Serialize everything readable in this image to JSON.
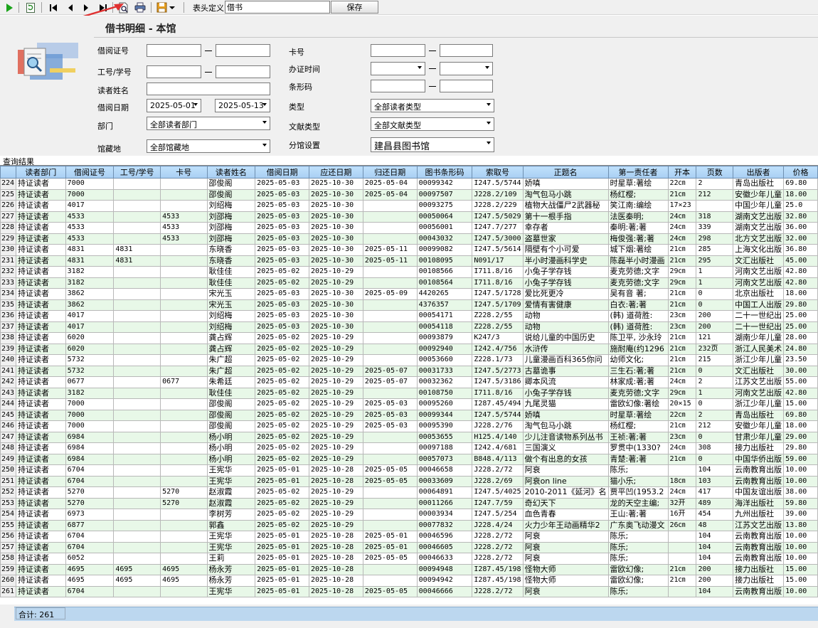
{
  "toolbar": {
    "header_def_label": "表头定义",
    "header_def_value": "借书",
    "save_label": "保存"
  },
  "page": {
    "title": "借书明细 - 本馆"
  },
  "filters": {
    "card_no_label": "借阅证号",
    "staff_no_label": "工号/学号",
    "reader_name_label": "读者姓名",
    "borrow_date_label": "借阅日期",
    "borrow_date_from": "2025-05-01",
    "borrow_date_to": "2025-05-13",
    "dept_label": "部门",
    "dept_value": "全部读者部门",
    "library_label": "馆藏地",
    "library_value": "全部馆藏地",
    "kahao_label": "卡号",
    "issue_time_label": "办证时间",
    "barcode_label": "条形码",
    "type_label": "类型",
    "type_value": "全部读者类型",
    "doc_type_label": "文献类型",
    "doc_type_value": "全部文献类型",
    "branch_label": "分馆设置",
    "branch_value": "建昌县图书馆"
  },
  "results_label": "查询结果",
  "table": {
    "columns": [
      "读者部门",
      "借阅证号",
      "工号/学号",
      "卡号",
      "读者姓名",
      "借阅日期",
      "应还日期",
      "归还日期",
      "图书条形码",
      "索取号",
      "正题名",
      "第一责任者",
      "开本",
      "页数",
      "出版者",
      "价格"
    ],
    "rows": [
      [
        "224",
        "持证读者",
        "7000",
        "",
        "",
        "邵俊阁",
        "2025-05-03",
        "2025-10-30",
        "2025-05-04",
        "00099342",
        "I247.5/5744",
        "娇嗔",
        "时星草:著绘",
        "22㎝",
        "2",
        "青岛出版社",
        "69.80"
      ],
      [
        "225",
        "持证读者",
        "7000",
        "",
        "",
        "邵俊阁",
        "2025-05-03",
        "2025-10-30",
        "2025-05-04",
        "00097507",
        "J228.2/109",
        "淘气包马小跳",
        "杨红樱;",
        "21㎝",
        "212",
        "安徽少年儿童",
        "18.00"
      ],
      [
        "226",
        "持证读者",
        "4017",
        "",
        "",
        "刘绍梅",
        "2025-05-03",
        "2025-10-30",
        "",
        "00093275",
        "J228.2/229",
        "植物大战僵尸2武器秘",
        "笑江南:编绘",
        "17×23",
        "",
        "中国少年儿童",
        "25.0"
      ],
      [
        "227",
        "持证读者",
        "4533",
        "",
        "4533",
        "刘邵梅",
        "2025-05-03",
        "2025-10-30",
        "",
        "00050064",
        "I247.5/5029",
        "第十一根手指",
        "法医秦明;",
        "24㎝",
        "318",
        "湖南文艺出版",
        "32.80"
      ],
      [
        "228",
        "持证读者",
        "4533",
        "",
        "4533",
        "刘邵梅",
        "2025-05-03",
        "2025-10-30",
        "",
        "00056001",
        "I247.7/277",
        "幸存者",
        "秦明:著;著",
        "24㎝",
        "339",
        "湖南文艺出版",
        "36.00"
      ],
      [
        "229",
        "持证读者",
        "4533",
        "",
        "4533",
        "刘邵梅",
        "2025-05-03",
        "2025-10-30",
        "",
        "00043032",
        "I247.5/3000",
        "盗墓世家",
        "梅俊强:著;著",
        "24㎝",
        "298",
        "北方文艺出版",
        "32.00"
      ],
      [
        "230",
        "持证读者",
        "4831",
        "4831",
        "",
        "东晓香",
        "2025-05-03",
        "2025-10-30",
        "2025-05-11",
        "00099082",
        "I247.5/5614",
        "隔壁有个小可爱",
        "城下烟:著绘",
        "21㎝",
        "285",
        "上海文化出版",
        "36.80"
      ],
      [
        "231",
        "持证读者",
        "4831",
        "4831",
        "",
        "东晓香",
        "2025-05-03",
        "2025-10-30",
        "2025-05-11",
        "00108095",
        "N091/17",
        "半小时漫画科学史",
        "陈磊半小时漫画",
        "21㎝",
        "295",
        "文汇出版社",
        "45.00"
      ],
      [
        "232",
        "持证读者",
        "3182",
        "",
        "",
        "耿佳佳",
        "2025-05-02",
        "2025-10-29",
        "",
        "00108566",
        "I711.8/16",
        "小兔子学存钱",
        "麦克劳德;文字",
        "29㎝",
        "1",
        "河南文艺出版",
        "42.80"
      ],
      [
        "233",
        "持证读者",
        "3182",
        "",
        "",
        "耿佳佳",
        "2025-05-02",
        "2025-10-29",
        "",
        "00108564",
        "I711.8/16",
        "小兔子学存钱",
        "麦克劳德;文字",
        "29㎝",
        "1",
        "河南文艺出版",
        "42.80"
      ],
      [
        "234",
        "持证读者",
        "3862",
        "",
        "",
        "宋光玉",
        "2025-05-03",
        "2025-10-30",
        "2025-05-09",
        "4420265",
        "I247.5/1728",
        "爱比死更冷",
        "吴有音 著;",
        "21㎝",
        "0",
        "北京出版社",
        "18.00"
      ],
      [
        "235",
        "持证读者",
        "3862",
        "",
        "",
        "宋光玉",
        "2025-05-03",
        "2025-10-30",
        "",
        "4376357",
        "I247.5/1709",
        "爱情有害健康",
        "白衣:著;著",
        "21㎝",
        "0",
        "中国工人出版",
        "29.80"
      ],
      [
        "236",
        "持证读者",
        "4017",
        "",
        "",
        "刘绍梅",
        "2025-05-03",
        "2025-10-30",
        "",
        "00054171",
        "Z228.2/55",
        "动物",
        "(韩) 道荷胜:",
        "23㎝",
        "200",
        "二十一世纪出",
        "25.00"
      ],
      [
        "237",
        "持证读者",
        "4017",
        "",
        "",
        "刘绍梅",
        "2025-05-03",
        "2025-10-30",
        "",
        "00054118",
        "Z228.2/55",
        "动物",
        "(韩) 道荷胜:",
        "23㎝",
        "200",
        "二十一世纪出",
        "25.00"
      ],
      [
        "238",
        "持证读者",
        "6020",
        "",
        "",
        "龚占辉",
        "2025-05-02",
        "2025-10-29",
        "",
        "00093879",
        "K247/3",
        "说给儿童的中国历史",
        "陈卫平, 沙永玲",
        "21㎝",
        "121",
        "湖南少年儿童",
        "28.00"
      ],
      [
        "239",
        "持证读者",
        "6020",
        "",
        "",
        "龚占辉",
        "2025-05-02",
        "2025-10-29",
        "",
        "00092940",
        "I242.4/756",
        "水浒传",
        "施耐庵(约1296",
        "21㎝",
        "232页",
        "浙江人民美术",
        "24.80"
      ],
      [
        "240",
        "持证读者",
        "5732",
        "",
        "",
        "朱广超",
        "2025-05-02",
        "2025-10-29",
        "",
        "00053660",
        "Z228.1/73",
        "儿童漫画百科365你问",
        "幼师文化;",
        "21㎝",
        "215",
        "浙江少年儿童",
        "23.50"
      ],
      [
        "241",
        "持证读者",
        "5732",
        "",
        "",
        "朱广超",
        "2025-05-02",
        "2025-10-29",
        "2025-05-07",
        "00031733",
        "I247.5/2773",
        "古墓诡事",
        "三生石:著;著",
        "21㎝",
        "0",
        "文汇出版社",
        "30.00"
      ],
      [
        "242",
        "持证读者",
        "0677",
        "",
        "0677",
        "朱希廷",
        "2025-05-02",
        "2025-10-29",
        "2025-05-07",
        "00032362",
        "I247.5/3186",
        "卿本风流",
        "林家成:著;著",
        "24㎝",
        "2",
        "江苏文艺出版",
        "55.00"
      ],
      [
        "243",
        "持证读者",
        "3182",
        "",
        "",
        "耿佳佳",
        "2025-05-02",
        "2025-10-29",
        "",
        "00108750",
        "I711.8/16",
        "小兔子学存钱",
        "麦克劳德;文字",
        "29㎝",
        "1",
        "河南文艺出版",
        "42.80"
      ],
      [
        "244",
        "持证读者",
        "7000",
        "",
        "",
        "邵俊阁",
        "2025-05-02",
        "2025-10-29",
        "2025-05-03",
        "00095260",
        "I287.45/494",
        "九尾灵猫",
        "雷欧幻像:著绘",
        "20×15",
        "0",
        "浙江少年儿童",
        "15.00"
      ],
      [
        "245",
        "持证读者",
        "7000",
        "",
        "",
        "邵俊阁",
        "2025-05-02",
        "2025-10-29",
        "2025-05-03",
        "00099344",
        "I247.5/5744",
        "娇嗔",
        "时星草:著绘",
        "22㎝",
        "2",
        "青岛出版社",
        "69.80"
      ],
      [
        "246",
        "持证读者",
        "7000",
        "",
        "",
        "邵俊阁",
        "2025-05-02",
        "2025-10-29",
        "2025-05-03",
        "00095390",
        "J228.2/76",
        "淘气包马小跳",
        "杨红樱;",
        "21㎝",
        "212",
        "安徽少年儿童",
        "18.00"
      ],
      [
        "247",
        "持证读者",
        "6984",
        "",
        "",
        "杨小明",
        "2025-05-02",
        "2025-10-29",
        "",
        "00053655",
        "H125.4/140",
        "少儿注音读物系列丛书",
        "王祯:著;著",
        "23㎝",
        "0",
        "甘肃少年儿童",
        "29.00"
      ],
      [
        "248",
        "持证读者",
        "6984",
        "",
        "",
        "杨小明",
        "2025-05-02",
        "2025-10-29",
        "",
        "00097188",
        "I242.4/681",
        "三国演义",
        "罗贯中(1330?",
        "24㎝",
        "308",
        "接力出版社",
        "29.80"
      ],
      [
        "249",
        "持证读者",
        "6984",
        "",
        "",
        "杨小明",
        "2025-05-02",
        "2025-10-29",
        "",
        "00057073",
        "B848.4/113",
        "做个有出息的女孩",
        "青楚:著;著",
        "21㎝",
        "0",
        "中国华侨出版",
        "59.00"
      ],
      [
        "250",
        "持证读者",
        "6704",
        "",
        "",
        "王宪华",
        "2025-05-01",
        "2025-10-28",
        "2025-05-05",
        "00046658",
        "J228.2/72",
        "阿衰",
        "陈乐;",
        "",
        "104",
        "云南教育出版",
        "10.00"
      ],
      [
        "251",
        "持证读者",
        "6704",
        "",
        "",
        "王宪华",
        "2025-05-01",
        "2025-10-28",
        "2025-05-05",
        "00033609",
        "J228.2/69",
        "阿衰on line",
        "猫小乐;",
        "18㎝",
        "103",
        "云南教育出版",
        "10.00"
      ],
      [
        "252",
        "持证读者",
        "5270",
        "",
        "5270",
        "赵淑霞",
        "2025-05-02",
        "2025-10-29",
        "",
        "00064891",
        "I247.5/4025",
        "2010-2011《延河》名",
        "贾平凹(1953.2",
        "24㎝",
        "417",
        "中国友谊出版",
        "38.00"
      ],
      [
        "253",
        "持证读者",
        "5270",
        "",
        "5270",
        "赵淑霞",
        "2025-05-02",
        "2025-10-29",
        "",
        "00011266",
        "I247.7/59",
        "奇幻天下",
        "龙的天空主编;",
        "32开",
        "489",
        "海洋出版社",
        "59.80"
      ],
      [
        "254",
        "持证读者",
        "6973",
        "",
        "",
        "李树芳",
        "2025-05-02",
        "2025-10-29",
        "",
        "00003934",
        "I247.5/254",
        "血色青春",
        "王山:著;著",
        "16开",
        "454",
        "九州出版社",
        "39.00"
      ],
      [
        "255",
        "持证读者",
        "6877",
        "",
        "",
        "郭鑫",
        "2025-05-02",
        "2025-10-29",
        "",
        "00077832",
        "J228.4/24",
        "火力少年王动画精华2",
        "广东奥飞动漫文",
        "26㎝",
        "48",
        "江苏文艺出版",
        "13.80"
      ],
      [
        "256",
        "持证读者",
        "6704",
        "",
        "",
        "王宪华",
        "2025-05-01",
        "2025-10-28",
        "2025-05-01",
        "00046596",
        "J228.2/72",
        "阿衰",
        "陈乐;",
        "",
        "104",
        "云南教育出版",
        "10.00"
      ],
      [
        "257",
        "持证读者",
        "6704",
        "",
        "",
        "王宪华",
        "2025-05-01",
        "2025-10-28",
        "2025-05-01",
        "00046605",
        "J228.2/72",
        "阿衰",
        "陈乐;",
        "",
        "104",
        "云南教育出版",
        "10.00"
      ],
      [
        "258",
        "持证读者",
        "6052",
        "",
        "",
        "王莉",
        "2025-05-01",
        "2025-10-28",
        "2025-05-05",
        "00046633",
        "J228.2/72",
        "阿衰",
        "陈乐;",
        "",
        "104",
        "云南教育出版",
        "10.00"
      ],
      [
        "259",
        "持证读者",
        "4695",
        "4695",
        "4695",
        "杨永芳",
        "2025-05-01",
        "2025-10-28",
        "",
        "00094948",
        "I287.45/198",
        "怪物大师",
        "雷欧幻像;",
        "21㎝",
        "200",
        "接力出版社",
        "15.00"
      ],
      [
        "260",
        "持证读者",
        "4695",
        "4695",
        "4695",
        "杨永芳",
        "2025-05-01",
        "2025-10-28",
        "",
        "00094942",
        "I287.45/198",
        "怪物大师",
        "雷欧幻像;",
        "21㎝",
        "200",
        "接力出版社",
        "15.00"
      ],
      [
        "261",
        "持证读者",
        "6704",
        "",
        "",
        "王宪华",
        "2025-05-01",
        "2025-10-28",
        "2025-05-05",
        "00046666",
        "J228.2/72",
        "阿衰",
        "陈乐;",
        "",
        "104",
        "云南教育出版",
        "10.00"
      ]
    ]
  },
  "footer": {
    "total": "合计: 261"
  },
  "colors": {
    "header_bg": "#a9cff3",
    "even_row_bg": "#e8f8e8",
    "footer_bg": "#bcd7ef",
    "arrow": "#e03030"
  },
  "icons": [
    "run-icon",
    "refresh-icon",
    "first-record-icon",
    "prev-record-icon",
    "next-record-icon",
    "last-record-icon",
    "print-preview-icon",
    "print-icon",
    "save-disk-icon",
    "dropdown-arrow-icon"
  ]
}
